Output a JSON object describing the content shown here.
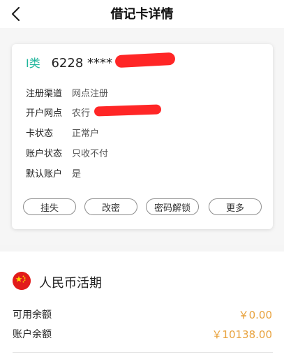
{
  "header": {
    "title": "借记卡详情",
    "back_icon": "chevron-left-icon"
  },
  "card": {
    "type_label": "I类",
    "number_prefix": "6228 ****",
    "info": [
      {
        "label": "注册渠道",
        "value": "网点注册"
      },
      {
        "label": "开户网点",
        "value": "农行"
      },
      {
        "label": "卡状态",
        "value": "正常户"
      },
      {
        "label": "账户状态",
        "value": "只收不付"
      },
      {
        "label": "默认账户",
        "value": "是"
      }
    ],
    "actions": [
      "挂失",
      "改密",
      "密码解锁",
      "更多"
    ]
  },
  "currency": {
    "flag_icon": "china-flag-icon",
    "title": "人民币活期",
    "available_label": "可用余额",
    "available_value": "￥0.00",
    "balance_label": "账户余额",
    "balance_value": "￥10138.00"
  },
  "colors": {
    "accent_teal": "#1fb59b",
    "amount_orange": "#e8a23d",
    "redaction_red": "#ff1a1a"
  }
}
